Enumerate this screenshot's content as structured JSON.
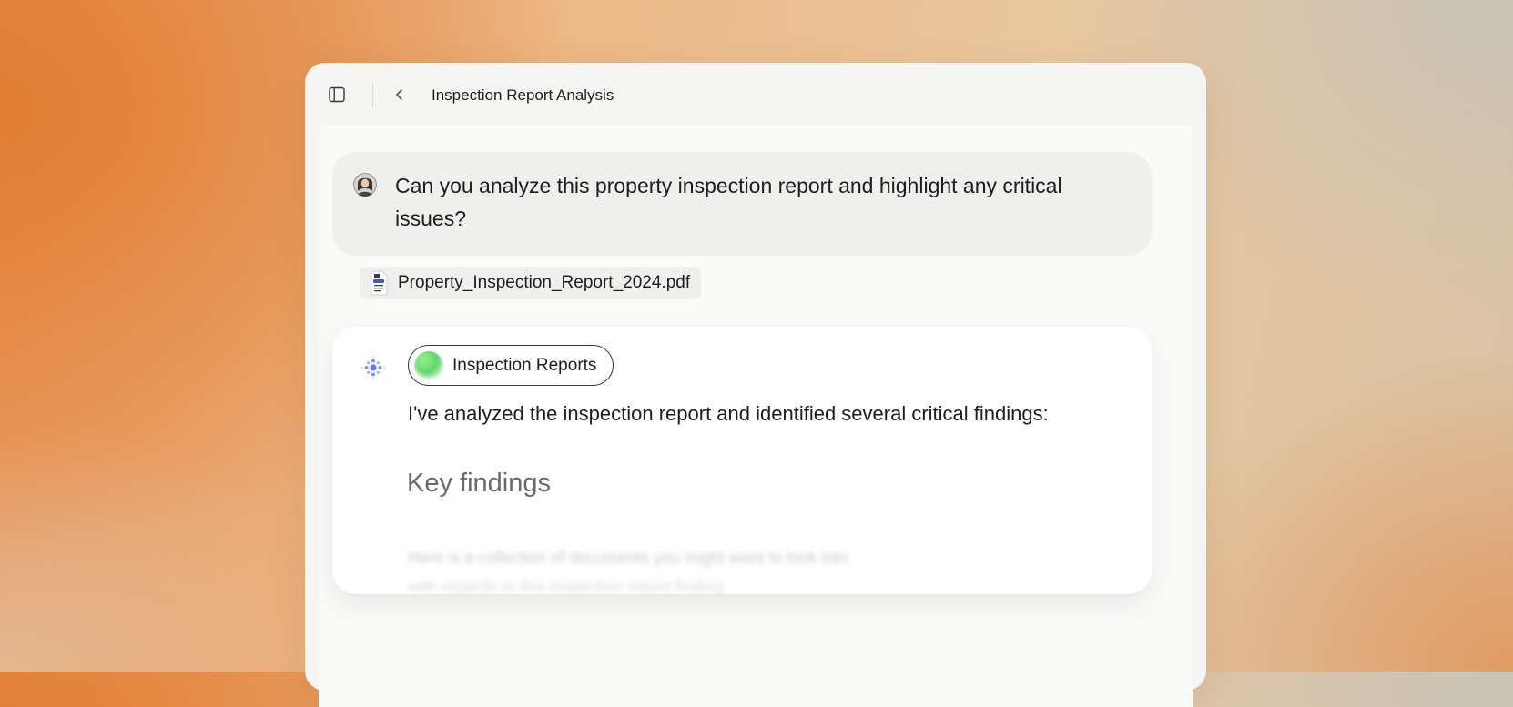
{
  "window": {
    "title": "Inspection Report Analysis",
    "icons": {
      "sidebar_toggle": "sidebar-icon",
      "back": "chevron-left-icon"
    }
  },
  "conversation": {
    "user_message": {
      "text": "Can you analyze this property inspection report and highlight any critical issues?",
      "avatar": "user-avatar"
    },
    "attachment": {
      "file_name": "Property_Inspection_Report_2024.pdf",
      "icon": "pdf-file-icon"
    },
    "assistant_message": {
      "collection_chip": "Inspection Reports",
      "intro": "I've analyzed the inspection report and identified several critical findings:",
      "heading": "Key findings",
      "blurred_text": "Here is a collection of documents you might want to look into with regards to this inspection report finding",
      "logo_icon": "assistant-logo-icon"
    }
  },
  "colors": {
    "chip_accent": "#5fd86b",
    "assistant_logo": "#5b7fe0"
  }
}
